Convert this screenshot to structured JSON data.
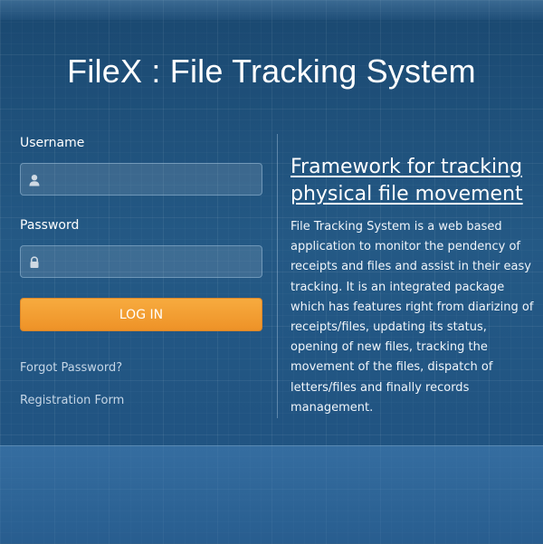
{
  "header": {
    "title": "FileX : File Tracking System"
  },
  "login": {
    "username_label": "Username",
    "username_value": "",
    "password_label": "Password",
    "password_value": "",
    "submit_label": "LOG IN"
  },
  "links": {
    "forgot_password": "Forgot Password?",
    "registration": "Registration Form"
  },
  "info": {
    "heading_line1": "Framework for tracking",
    "heading_line2": "physical file movement",
    "description": "File Tracking System is a web based application to monitor the pendency of receipts and files and assist in their easy tracking. It is an integrated package which has features right from diarizing of receipts/files, updating its status, opening of new files, tracking the movement of the files, dispatch of letters/files and finally records management."
  },
  "icons": {
    "username": "user-icon",
    "password": "lock-icon"
  },
  "colors": {
    "background": "#1e4f7a",
    "button": "#f29b30",
    "link": "#c5d6e6"
  }
}
